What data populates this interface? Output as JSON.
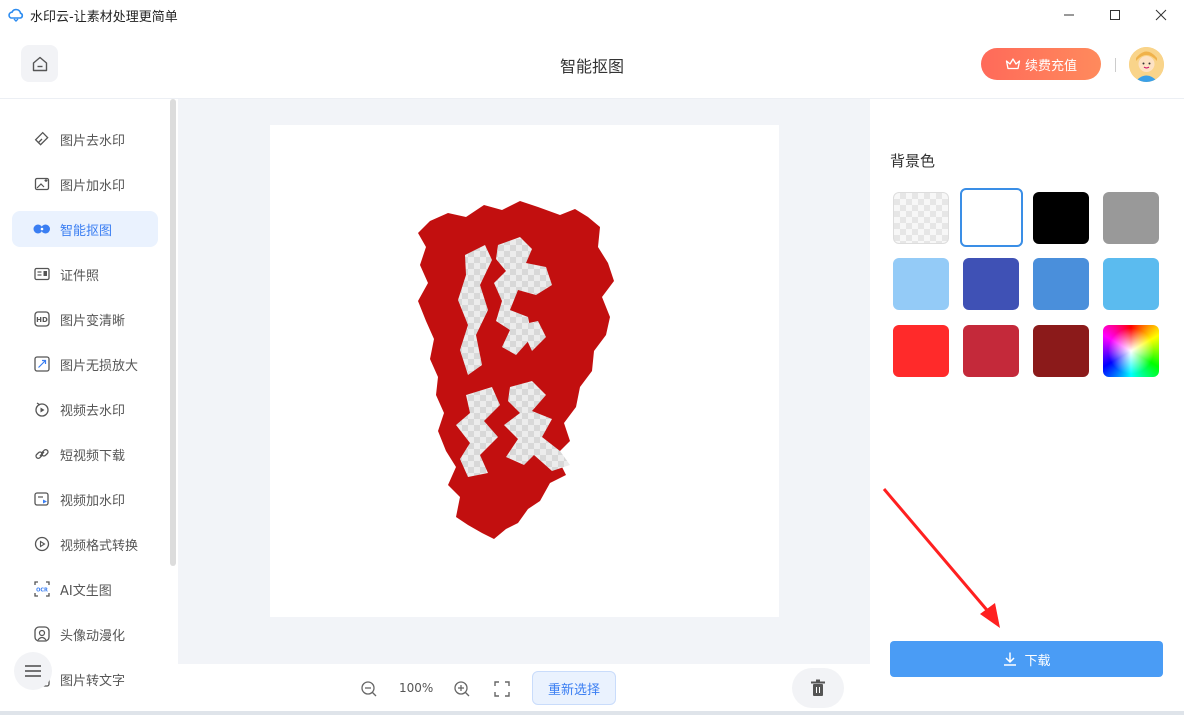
{
  "window": {
    "title": "水印云-让素材处理更简单",
    "controls": [
      "—",
      "☐",
      "✕"
    ]
  },
  "header": {
    "page_title": "智能抠图",
    "vip_button": "续费充值"
  },
  "sidebar": {
    "items": [
      {
        "label": "图片去水印",
        "icon": "eraser-icon"
      },
      {
        "label": "图片加水印",
        "icon": "image-plus-icon"
      },
      {
        "label": "智能抠图",
        "icon": "cutout-icon",
        "active": true
      },
      {
        "label": "证件照",
        "icon": "id-card-icon"
      },
      {
        "label": "图片变清晰",
        "icon": "hd-icon"
      },
      {
        "label": "图片无损放大",
        "icon": "enlarge-icon"
      },
      {
        "label": "视频去水印",
        "icon": "video-erase-icon"
      },
      {
        "label": "短视频下载",
        "icon": "link-icon"
      },
      {
        "label": "视频加水印",
        "icon": "video-plus-icon"
      },
      {
        "label": "视频格式转换",
        "icon": "play-circle-icon"
      },
      {
        "label": "AI文生图",
        "icon": "ai-image-icon"
      },
      {
        "label": "头像动漫化",
        "icon": "avatar-anime-icon"
      },
      {
        "label": "图片转文字",
        "icon": "ocr-icon"
      }
    ]
  },
  "canvas": {
    "zoom": "100%",
    "reselect_button": "重新选择"
  },
  "right_panel": {
    "bg_label": "背景色",
    "swatches": [
      {
        "name": "transparent",
        "color": "transparent"
      },
      {
        "name": "white",
        "color": "#ffffff",
        "selected": true
      },
      {
        "name": "black",
        "color": "#000000"
      },
      {
        "name": "gray",
        "color": "#999999"
      },
      {
        "name": "light-blue",
        "color": "#94cbf7"
      },
      {
        "name": "indigo",
        "color": "#3f51b5"
      },
      {
        "name": "blue",
        "color": "#4a8fdb"
      },
      {
        "name": "sky-blue",
        "color": "#5bbbef"
      },
      {
        "name": "red",
        "color": "#ff2a2a"
      },
      {
        "name": "crimson",
        "color": "#c4293a"
      },
      {
        "name": "dark-red",
        "color": "#8b1a1a"
      },
      {
        "name": "custom",
        "color": "rainbow"
      }
    ],
    "download_button": "下载"
  },
  "colors": {
    "accent": "#3a7ef2",
    "download": "#4a9cf5",
    "seal_red": "#c20f0f",
    "annotation_arrow": "#ff2020"
  }
}
